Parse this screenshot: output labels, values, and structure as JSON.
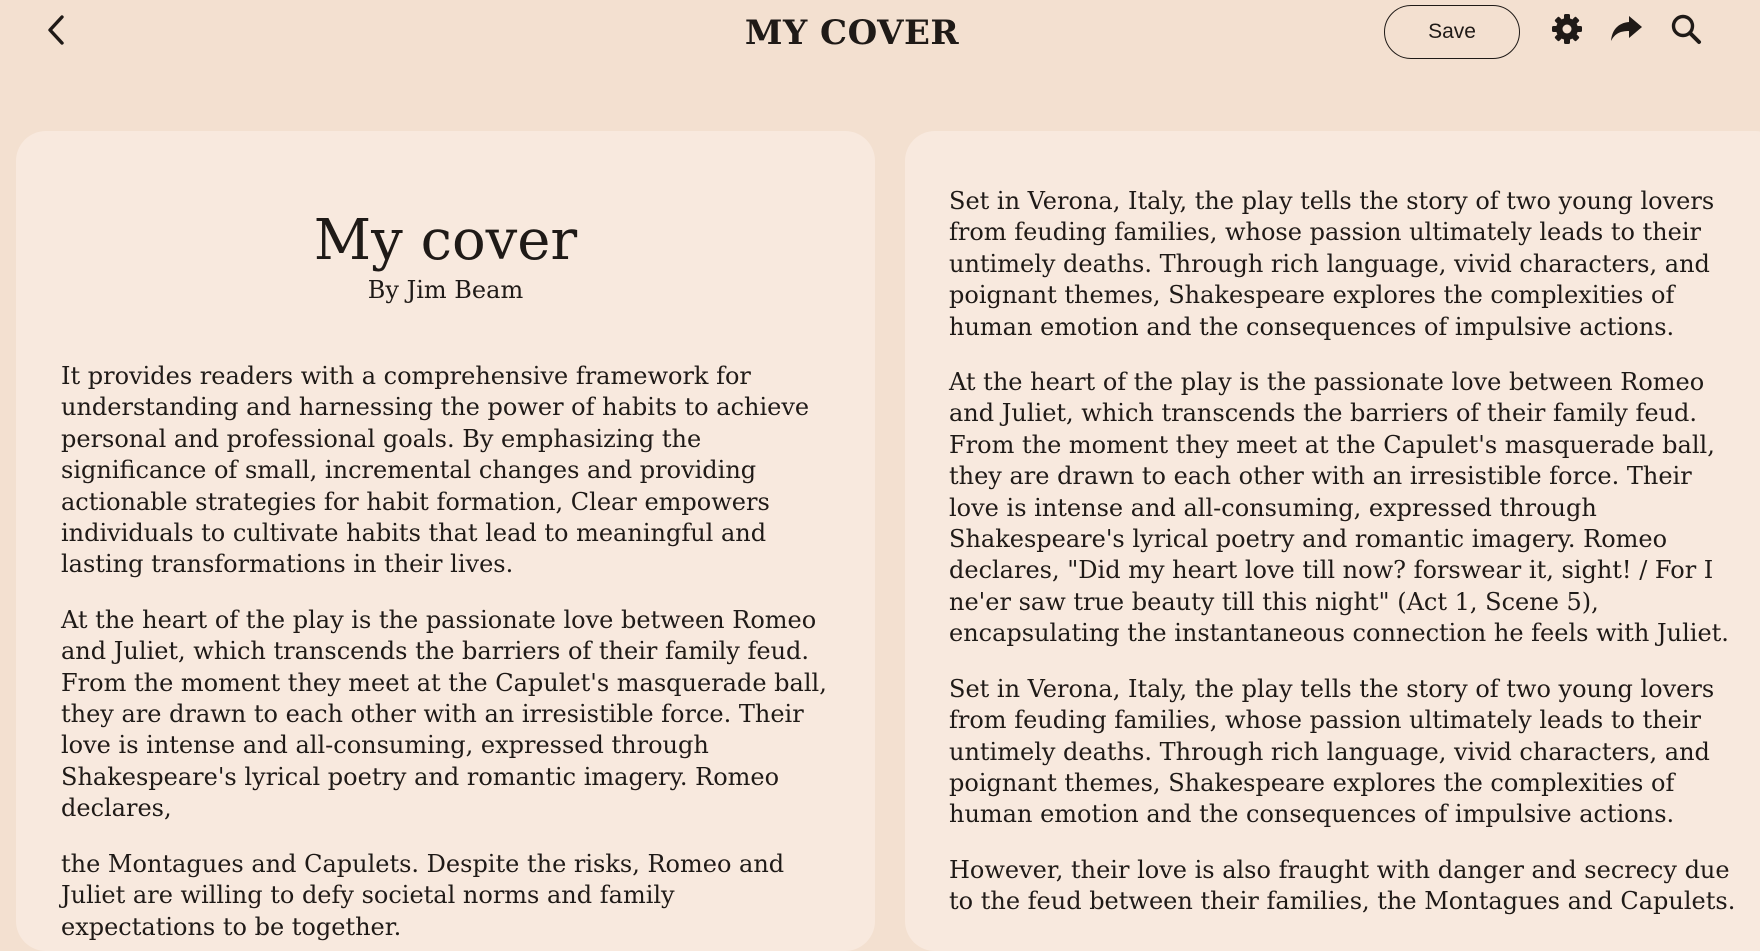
{
  "header": {
    "title": "MY COVER",
    "save_label": "Save",
    "icons": [
      "back-icon",
      "gear-icon",
      "share-icon",
      "search-icon"
    ]
  },
  "left_page": {
    "heading": "My cover",
    "author": "By Jim Beam",
    "paragraphs": [
      "It provides readers with a comprehensive framework for understanding and harnessing the power of habits to achieve personal and professional goals. By emphasizing the significance of small, incremental changes and providing actionable strategies for habit formation, Clear empowers individuals to cultivate habits that lead to meaningful and lasting transformations in their lives.",
      "At the heart of the play is the passionate love between Romeo and Juliet, which transcends the barriers of their family feud. From the moment they meet at the Capulet's masquerade ball, they are drawn to each other with an irresistible force. Their love is intense and all-consuming, expressed through Shakespeare's lyrical poetry and romantic imagery. Romeo declares,",
      "the Montagues and Capulets. Despite the risks, Romeo and Juliet are willing to defy societal norms and family expectations to be together."
    ]
  },
  "right_page": {
    "paragraphs": [
      "Set in Verona, Italy, the play tells the story of two young lovers from feuding families, whose passion ultimately leads to their untimely deaths. Through rich language, vivid characters, and poignant themes, Shakespeare explores the complexities of human emotion and the consequences of impulsive actions.",
      "At the heart of the play is the passionate love between Romeo and Juliet, which transcends the barriers of their family feud. From the moment they meet at the Capulet's masquerade ball, they are drawn to each other with an irresistible force. Their love is intense and all-consuming, expressed through Shakespeare's lyrical poetry and romantic imagery. Romeo declares, \"Did my heart love till now? forswear it, sight! / For I ne'er saw true beauty till this night\" (Act 1, Scene 5), encapsulating the instantaneous connection he feels with Juliet.",
      "Set in Verona, Italy, the play tells the story of two young lovers from feuding families, whose passion ultimately leads to their untimely deaths. Through rich language, vivid characters, and poignant themes, Shakespeare explores the complexities of human emotion and the consequences of impulsive actions.",
      "However, their love is also fraught with danger and secrecy due to the feud between their families, the Montagues and Capulets."
    ]
  },
  "colors": {
    "background": "#f3e0d0",
    "page": "#f8e9de",
    "text": "#1f1a17"
  }
}
